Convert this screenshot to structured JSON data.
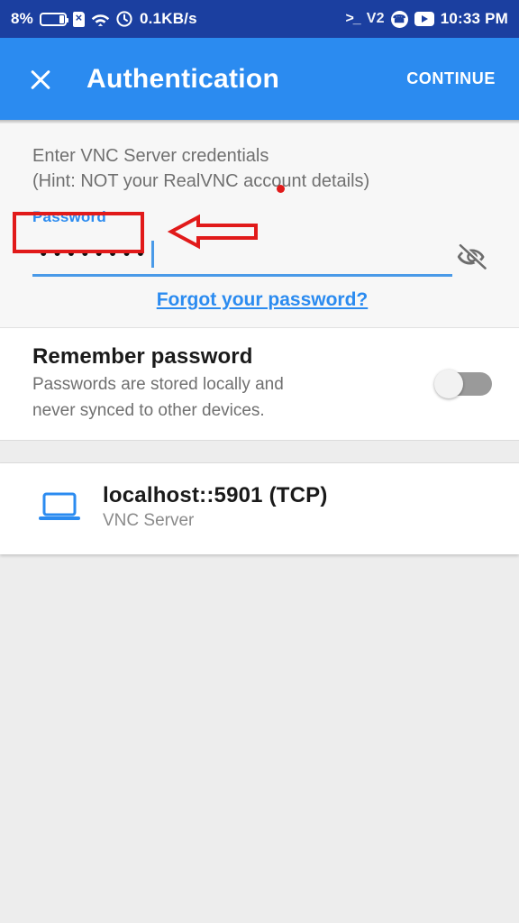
{
  "status_bar": {
    "battery_percent": "8%",
    "battery_icon": "battery-icon",
    "sim_icon": "sim-card-icon",
    "wifi_icon": "wifi-icon",
    "clock_small_icon": "clock-icon",
    "network_speed": "0.1KB/s",
    "terminal_icon": ">_",
    "v2_icon": "V2",
    "phone_icon": "phone-icon",
    "youtube_icon": "youtube-icon",
    "time": "10:33 PM",
    "background_color": "#1b3fa0"
  },
  "app_bar": {
    "close_icon": "close-icon",
    "title": "Authentication",
    "continue_label": "CONTINUE",
    "background_color": "#2b8bf0"
  },
  "credentials": {
    "hint_line1": "Enter VNC Server credentials",
    "hint_line2": "(Hint: NOT your RealVNC account details)",
    "password_label": "Password",
    "password_value": "••••••••",
    "password_masked_char_count": 8,
    "show_password_icon": "eye-off-icon",
    "forgot_link": "Forgot your password?",
    "label_color": "#2b8bf0",
    "underline_color": "#4a9ae8"
  },
  "annotations": {
    "highlight_rect_color": "#e11a1a",
    "arrow_icon": "left-arrow-annotation",
    "arrow_color": "#e11a1a",
    "dot_color": "#e11a1a"
  },
  "remember": {
    "title": "Remember password",
    "subtitle_line1": "Passwords are stored locally and",
    "subtitle_line2": "never synced to other devices.",
    "toggle_state": "off",
    "toggle_track_color": "#9a9a9a"
  },
  "server": {
    "icon": "laptop-icon",
    "name": "localhost::5901 (TCP)",
    "type": "VNC Server",
    "icon_color": "#2b8bf0"
  }
}
